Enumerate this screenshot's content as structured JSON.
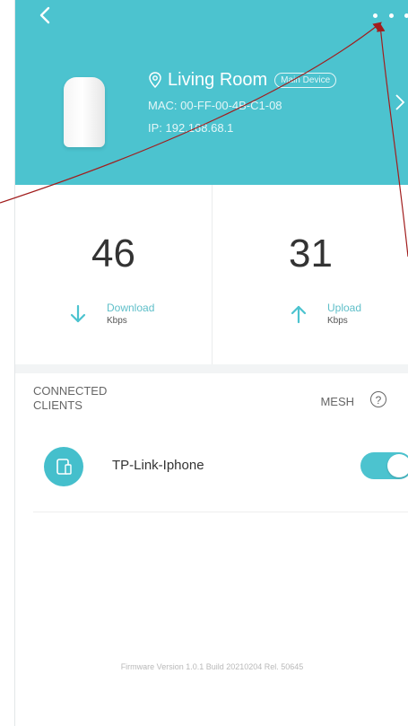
{
  "header": {
    "device": {
      "name": "Living Room",
      "role": "Main Device",
      "mac": "MAC: 00-FF-00-4B-C1-08",
      "ip": "IP: 192.168.68.1"
    }
  },
  "stats": {
    "download": {
      "value": "46",
      "label": "Download",
      "unit": "Kbps"
    },
    "upload": {
      "value": "31",
      "label": "Upload",
      "unit": "Kbps"
    }
  },
  "clients": {
    "section_label": "CONNECTED CLIENTS",
    "mesh_label": "MESH",
    "help_symbol": "?",
    "items": [
      {
        "name": "TP-Link-Iphone",
        "enabled": true
      }
    ]
  },
  "footer": {
    "firmware": "Firmware Version 1.0.1 Build 20210204 Rel. 50645"
  },
  "colors": {
    "accent": "#4cc3cf",
    "annotation_arrow": "#a11d1d"
  },
  "icons": {
    "back": "back-arrow-icon",
    "more": "more-dots-icon",
    "location": "location-pin-icon",
    "download": "download-arrow-icon",
    "upload": "upload-arrow-icon",
    "client": "phone-device-icon",
    "help": "help-icon"
  }
}
